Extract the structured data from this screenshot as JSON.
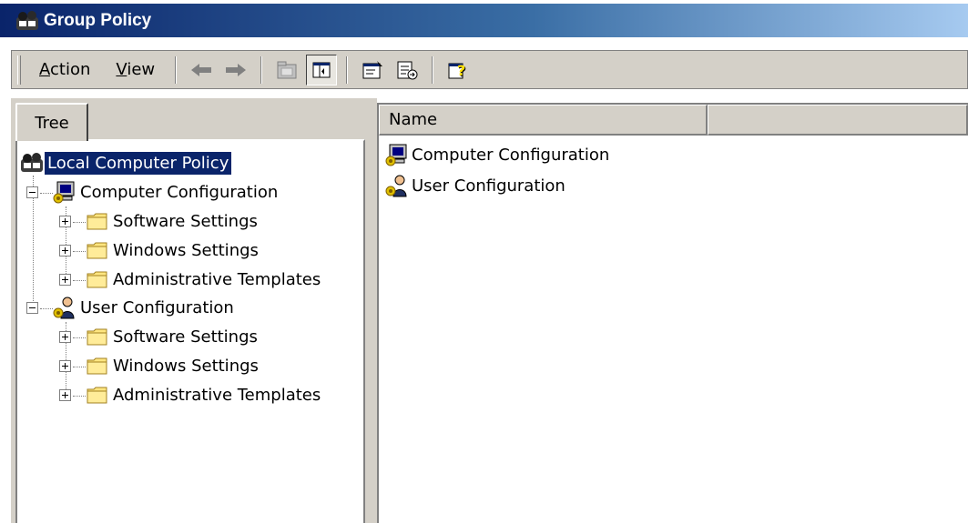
{
  "window": {
    "title": "Group Policy"
  },
  "menu": {
    "action": {
      "accel": "A",
      "rest": "ction"
    },
    "view": {
      "accel": "V",
      "rest": "iew"
    }
  },
  "toolbar": {
    "buttons": [
      "back-arrow-icon",
      "forward-arrow-icon",
      "up-folder-icon",
      "show-hide-tree-icon",
      "properties-icon",
      "export-list-icon",
      "help-icon"
    ]
  },
  "tree": {
    "tab_label": "Tree",
    "root": "Local Computer Policy",
    "computer": {
      "label": "Computer Configuration",
      "children": [
        "Software Settings",
        "Windows Settings",
        "Administrative Templates"
      ]
    },
    "user": {
      "label": "User Configuration",
      "children": [
        "Software Settings",
        "Windows Settings",
        "Administrative Templates"
      ]
    }
  },
  "list": {
    "columns": [
      "Name",
      ""
    ],
    "items": [
      "Computer Configuration",
      "User Configuration"
    ]
  },
  "colors": {
    "title_start": "#0a246a",
    "title_end": "#a6caf0",
    "selection": "#0a246a",
    "face": "#d4d0c8",
    "folder": "#ffe680"
  }
}
